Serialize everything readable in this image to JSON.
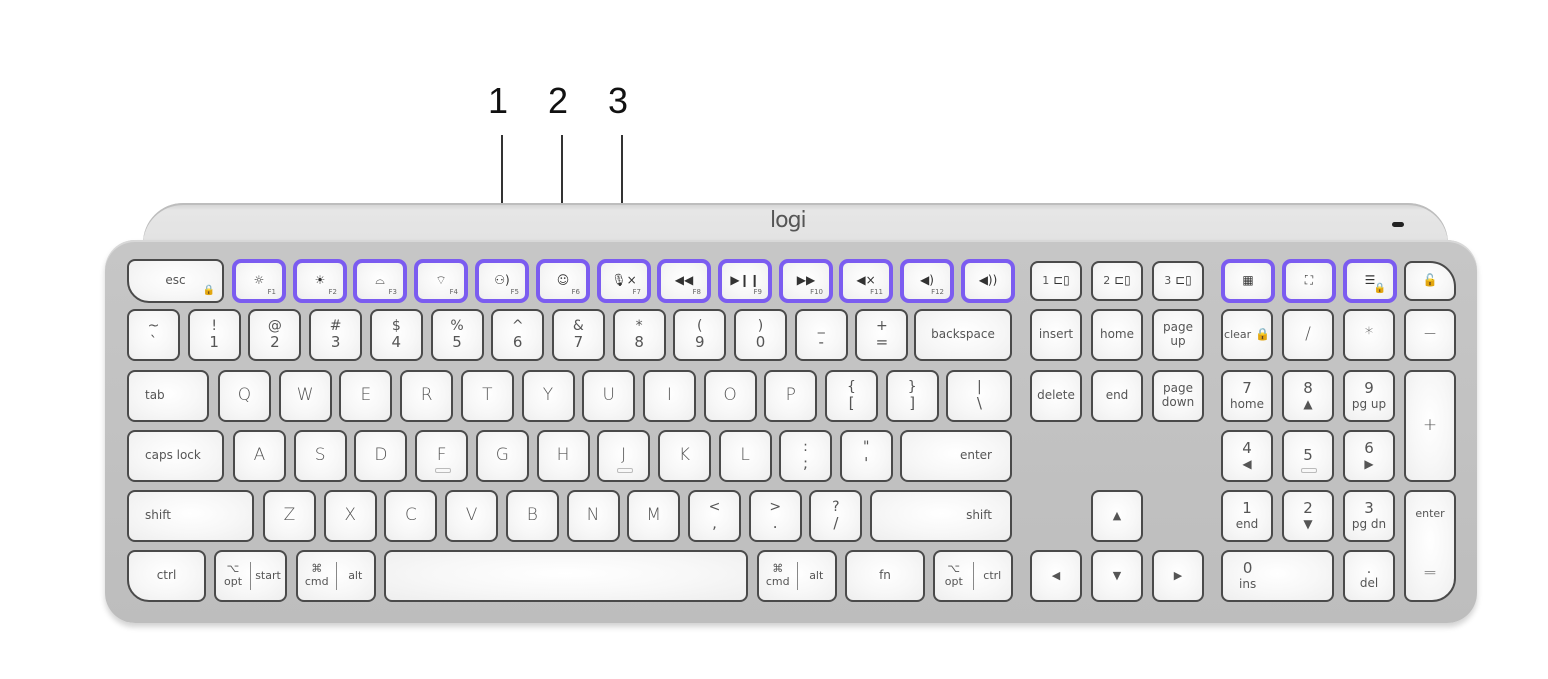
{
  "callouts": [
    {
      "label": "1",
      "target": "F5 dictation key"
    },
    {
      "label": "2",
      "target": "F6 emoji key"
    },
    {
      "label": "3",
      "target": "F7 mic mute key"
    }
  ],
  "brand": "logi",
  "highlight_color": "#7b5cf0",
  "fn_row": {
    "esc": "esc",
    "fkeys": [
      {
        "fn": "F1",
        "icon": "brightness-down-icon",
        "glyph": "☼"
      },
      {
        "fn": "F2",
        "icon": "brightness-up-icon",
        "glyph": "☀"
      },
      {
        "fn": "F3",
        "icon": "backlight-down-icon",
        "glyph": "⌓"
      },
      {
        "fn": "F4",
        "icon": "backlight-up-icon",
        "glyph": "⌔"
      },
      {
        "fn": "F5",
        "icon": "dictation-icon",
        "glyph": "⚇)"
      },
      {
        "fn": "F6",
        "icon": "emoji-icon",
        "glyph": "☺"
      },
      {
        "fn": "F7",
        "icon": "mic-mute-icon",
        "glyph": "🎙×"
      },
      {
        "fn": "F8",
        "icon": "previous-track-icon",
        "glyph": "◀◀"
      },
      {
        "fn": "F9",
        "icon": "play-pause-icon",
        "glyph": "▶❙❙"
      },
      {
        "fn": "F10",
        "icon": "next-track-icon",
        "glyph": "▶▶"
      },
      {
        "fn": "F11",
        "icon": "mute-icon",
        "glyph": "◀×"
      },
      {
        "fn": "F12",
        "icon": "volume-down-icon",
        "glyph": "◀)"
      },
      {
        "fn": "",
        "icon": "volume-up-icon",
        "glyph": "◀))"
      }
    ],
    "easy_switch": [
      "1",
      "2",
      "3"
    ],
    "extras": [
      {
        "icon": "calculator-icon",
        "glyph": "▦"
      },
      {
        "icon": "screenshot-icon",
        "glyph": "⛶"
      },
      {
        "icon": "context-menu-icon",
        "glyph": "☰"
      },
      {
        "icon": "lock-icon",
        "glyph": "🔓"
      }
    ]
  },
  "number_row": [
    {
      "top": "~",
      "bottom": "`"
    },
    {
      "top": "!",
      "bottom": "1"
    },
    {
      "top": "@",
      "bottom": "2"
    },
    {
      "top": "#",
      "bottom": "3"
    },
    {
      "top": "$",
      "bottom": "4"
    },
    {
      "top": "%",
      "bottom": "5"
    },
    {
      "top": "^",
      "bottom": "6"
    },
    {
      "top": "&",
      "bottom": "7"
    },
    {
      "top": "*",
      "bottom": "8"
    },
    {
      "top": "(",
      "bottom": "9"
    },
    {
      "top": ")",
      "bottom": "0"
    },
    {
      "top": "_",
      "bottom": "-"
    },
    {
      "top": "+",
      "bottom": "="
    }
  ],
  "backspace": "backspace",
  "tab": "tab",
  "qwerty": [
    "Q",
    "W",
    "E",
    "R",
    "T",
    "Y",
    "U",
    "I",
    "O",
    "P"
  ],
  "bracket_keys": [
    {
      "top": "{",
      "bottom": "["
    },
    {
      "top": "}",
      "bottom": "]"
    },
    {
      "top": "|",
      "bottom": "\\"
    }
  ],
  "caps": "caps lock",
  "home_row": [
    "A",
    "S",
    "D",
    "F",
    "G",
    "H",
    "J",
    "K",
    "L"
  ],
  "home_punct": [
    {
      "top": ":",
      "bottom": ";"
    },
    {
      "top": "\"",
      "bottom": "'"
    }
  ],
  "enter": "enter",
  "shift": "shift",
  "bottom_alpha": [
    "Z",
    "X",
    "C",
    "V",
    "B",
    "N",
    "M"
  ],
  "bottom_punct": [
    {
      "top": "<",
      "bottom": ","
    },
    {
      "top": ">",
      "bottom": "."
    },
    {
      "top": "?",
      "bottom": "/"
    }
  ],
  "mod_row": {
    "ctrl": "ctrl",
    "opt_symbol": "⌥",
    "opt": "opt",
    "start": "start",
    "cmd_symbol": "⌘",
    "cmd": "cmd",
    "alt": "alt",
    "fn": "fn"
  },
  "nav": {
    "insert": "insert",
    "home": "home",
    "page_up": "page up",
    "delete": "delete",
    "end": "end",
    "page_down": "page down",
    "arrow_up": "▲",
    "arrow_left": "◀",
    "arrow_down": "▼",
    "arrow_right": "▶"
  },
  "numpad": {
    "clear": "clear",
    "slash": "/",
    "star": "*",
    "minus": "−",
    "plus": "+",
    "enter": "enter",
    "equals": "=",
    "keys": [
      {
        "top": "7",
        "bottom": "home"
      },
      {
        "top": "8",
        "bottom": "▲"
      },
      {
        "top": "9",
        "bottom": "pg up"
      },
      {
        "top": "4",
        "bottom": "◀"
      },
      {
        "top": "5",
        "bottom": ""
      },
      {
        "top": "6",
        "bottom": "▶"
      },
      {
        "top": "1",
        "bottom": "end"
      },
      {
        "top": "2",
        "bottom": "▼"
      },
      {
        "top": "3",
        "bottom": "pg dn"
      },
      {
        "top": "0",
        "bottom": "ins"
      },
      {
        "top": ".",
        "bottom": "del"
      }
    ]
  }
}
